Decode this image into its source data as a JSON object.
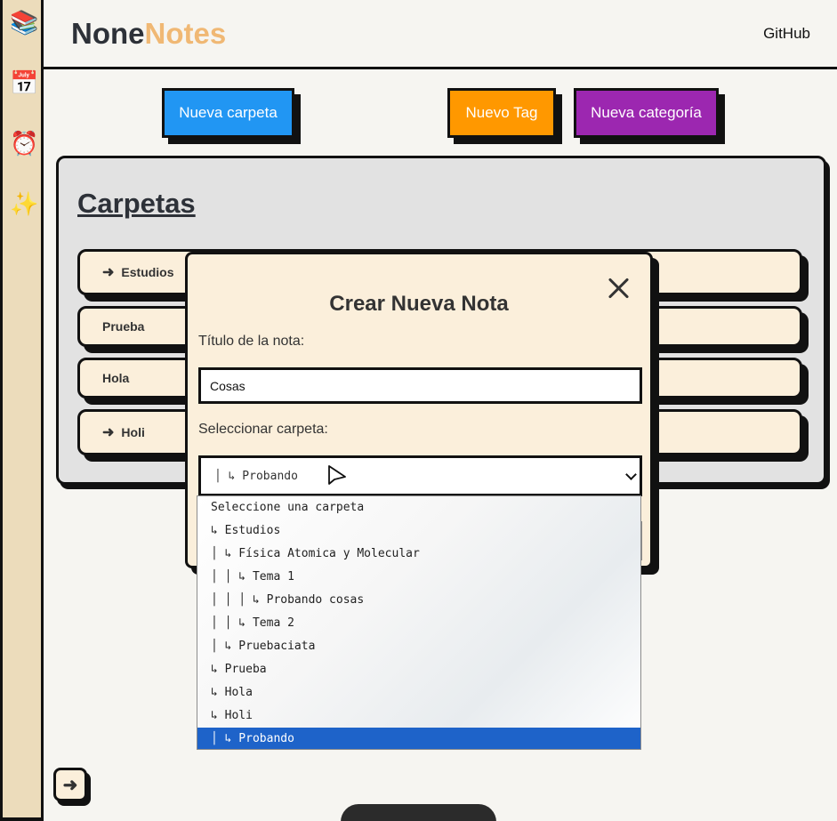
{
  "sidebar": {
    "items": [
      {
        "icon": "books-icon",
        "glyph": "📚"
      },
      {
        "icon": "calendar-icon",
        "glyph": "📅"
      },
      {
        "icon": "alarm-clock-icon",
        "glyph": "⏰"
      },
      {
        "icon": "sparkles-icon",
        "glyph": "✨"
      }
    ]
  },
  "header": {
    "logo_part1": "None",
    "logo_part2": "Notes",
    "github": "GitHub"
  },
  "actions": {
    "new_folder": "Nueva carpeta",
    "new_tag": "Nuevo Tag",
    "new_category": "Nueva categoría"
  },
  "panel": {
    "title": "Carpetas",
    "folders": [
      {
        "label": "Estudios",
        "arrow": "➜"
      },
      {
        "label": "Prueba",
        "arrow": ""
      },
      {
        "label": "Hola",
        "arrow": ""
      },
      {
        "label": "Holi",
        "arrow": "➜"
      }
    ]
  },
  "modal": {
    "title": "Crear Nueva Nota",
    "title_label": "Título de la nota:",
    "title_value": "Cosas",
    "folder_label": "Seleccionar carpeta:",
    "selected_folder": "│ ↳ Probando"
  },
  "dropdown": {
    "options": [
      "Seleccione una carpeta",
      "↳ Estudios",
      "│ ↳ Física Atomica y Molecular",
      "│ │ ↳ Tema 1",
      "│ │ │ ↳ Probando cosas",
      "│ │ ↳ Tema 2",
      "│ ↳ Pruebaciata",
      "↳ Prueba",
      "↳ Hola",
      "↳ Holi",
      "│ ↳ Probando"
    ],
    "selected_index": 10
  },
  "toggle": {
    "glyph": "➜"
  },
  "colors": {
    "accent_blue": "#2196f3",
    "accent_orange": "#ff9800",
    "accent_purple": "#9c27b0",
    "logo_orange": "#f0b874",
    "selected_option": "#1e63c9"
  }
}
